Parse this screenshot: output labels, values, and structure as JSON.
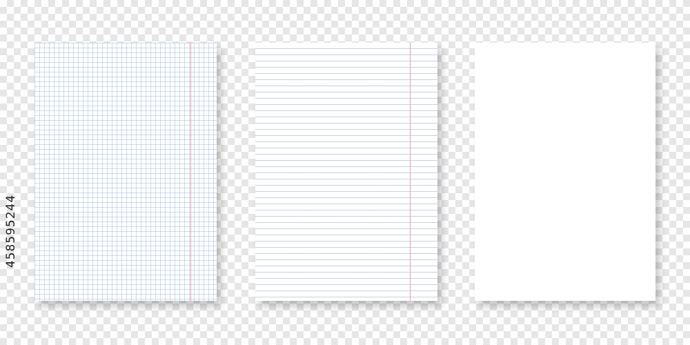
{
  "watermark": {
    "id_text": "458595244"
  },
  "sheets": [
    {
      "kind": "grid",
      "grid_color": "#91afdc",
      "margin_color": "#e7a0a8"
    },
    {
      "kind": "lined",
      "line_color": "#96aad2",
      "margin_color": "#e7a0a8"
    },
    {
      "kind": "blank"
    }
  ],
  "background": {
    "pattern": "checkerboard",
    "color_a": "#ffffff",
    "color_b": "#e6e6e6"
  }
}
